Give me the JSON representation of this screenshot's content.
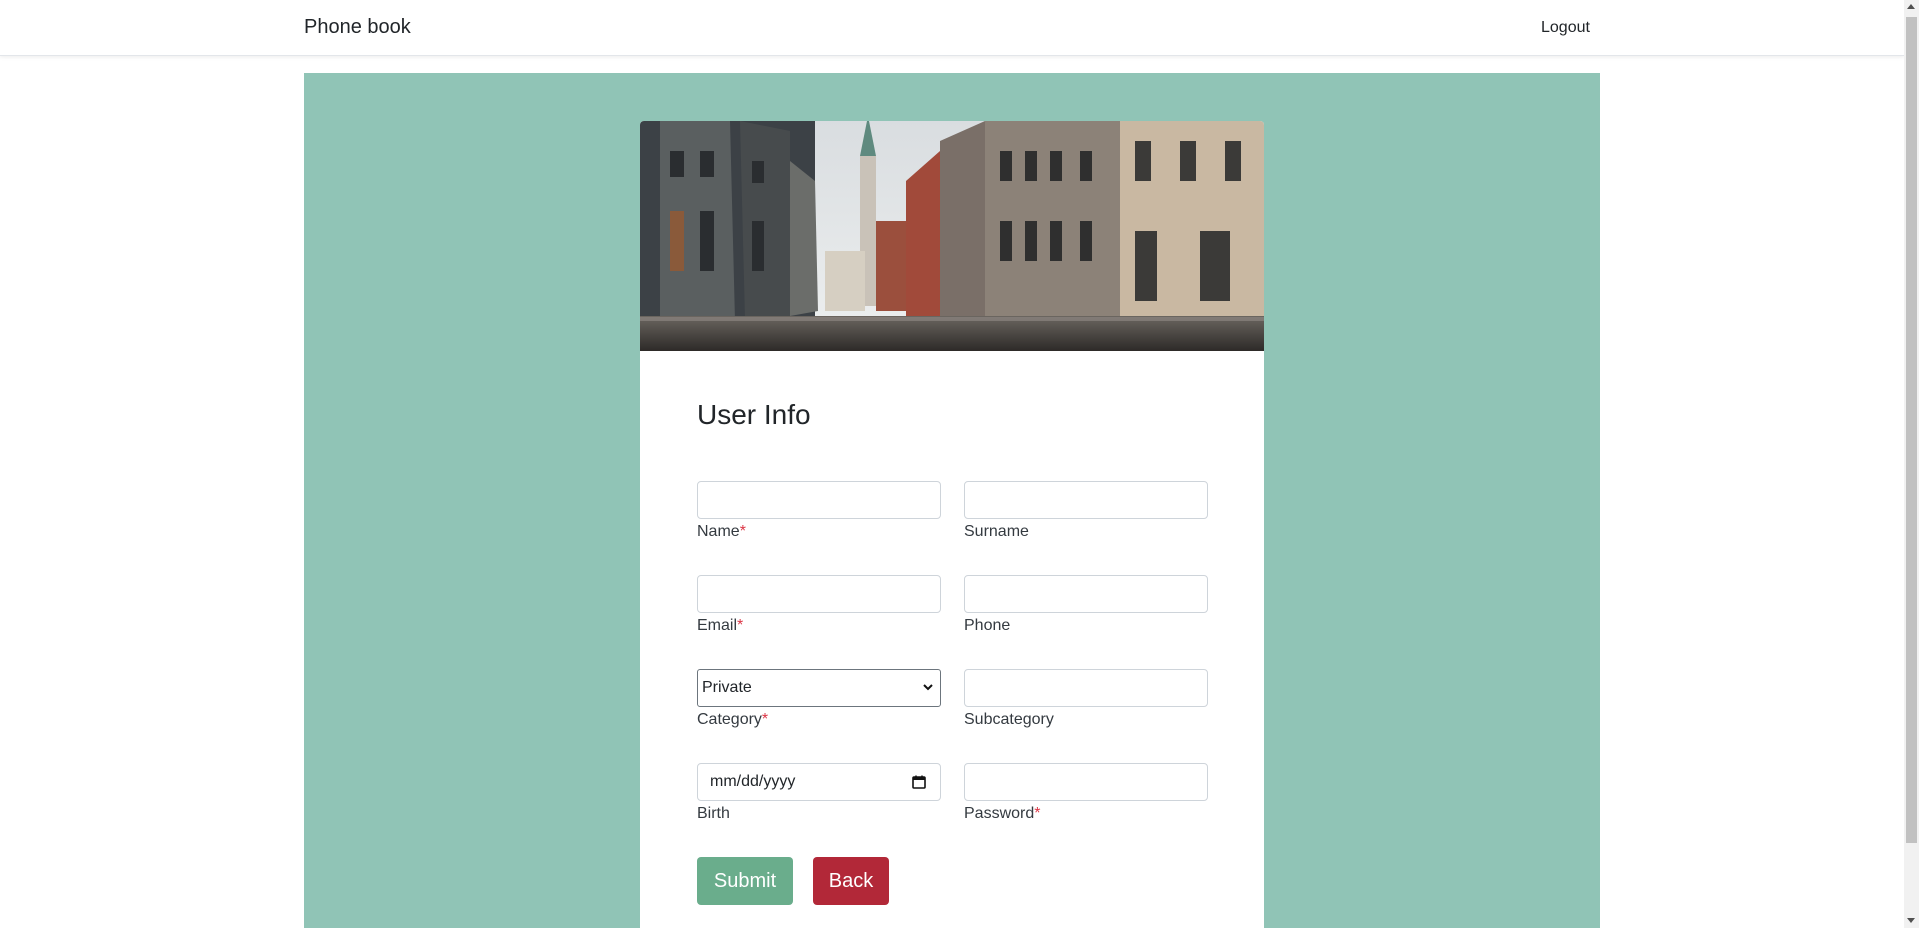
{
  "navbar": {
    "brand": "Phone book",
    "logout": "Logout"
  },
  "form": {
    "title": "User Info",
    "required_mark": "*",
    "fields": {
      "name": {
        "label": "Name",
        "value": "",
        "required": true
      },
      "surname": {
        "label": "Surname",
        "value": "",
        "required": false
      },
      "email": {
        "label": "Email",
        "value": "",
        "required": true
      },
      "phone": {
        "label": "Phone",
        "value": "",
        "required": false
      },
      "category": {
        "label": "Category",
        "selected": "Private",
        "required": true
      },
      "subcategory": {
        "label": "Subcategory",
        "value": "",
        "required": false
      },
      "birth": {
        "label": "Birth",
        "placeholder": "mm/dd/yyyy",
        "required": false
      },
      "password": {
        "label": "Password",
        "value": "",
        "required": true
      }
    },
    "buttons": {
      "submit": "Submit",
      "back": "Back"
    }
  },
  "colors": {
    "page_bg": "#90c4b6",
    "submit": "#6aad8c",
    "back": "#b22838",
    "required": "#dc3545"
  },
  "icons": {
    "hero": "city-street-photo",
    "calendar": "calendar-icon",
    "select": "chevron-down-icon"
  }
}
